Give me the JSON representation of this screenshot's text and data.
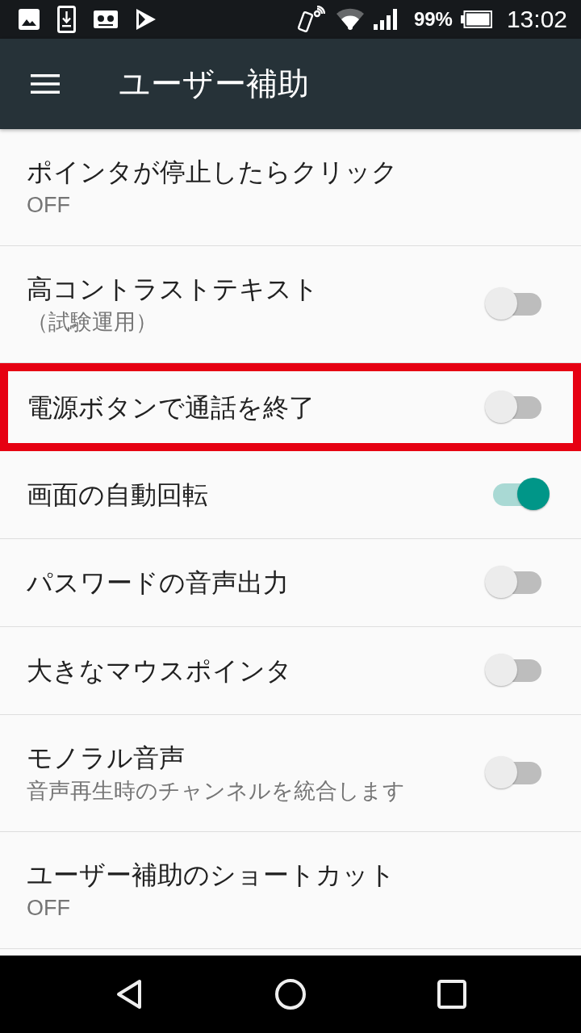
{
  "status_bar": {
    "battery_percent": "99%",
    "time": "13:02"
  },
  "app_bar": {
    "title": "ユーザー補助"
  },
  "settings": [
    {
      "kind": "text",
      "title": "ポインタが停止したらクリック",
      "summary": "OFF",
      "highlighted": false
    },
    {
      "kind": "switch",
      "title": "高コントラストテキスト",
      "summary": "（試験運用）",
      "on": false,
      "highlighted": false
    },
    {
      "kind": "switch",
      "title": "電源ボタンで通話を終了",
      "on": false,
      "highlighted": true
    },
    {
      "kind": "switch",
      "title": "画面の自動回転",
      "on": true,
      "highlighted": false
    },
    {
      "kind": "switch",
      "title": "パスワードの音声出力",
      "on": false,
      "highlighted": false
    },
    {
      "kind": "switch",
      "title": "大きなマウスポインタ",
      "on": false,
      "highlighted": false
    },
    {
      "kind": "switch",
      "title": "モノラル音声",
      "summary": "音声再生時のチャンネルを統合します",
      "on": false,
      "highlighted": false
    },
    {
      "kind": "text",
      "title": "ユーザー補助のショートカット",
      "summary": "OFF",
      "highlighted": false
    }
  ]
}
